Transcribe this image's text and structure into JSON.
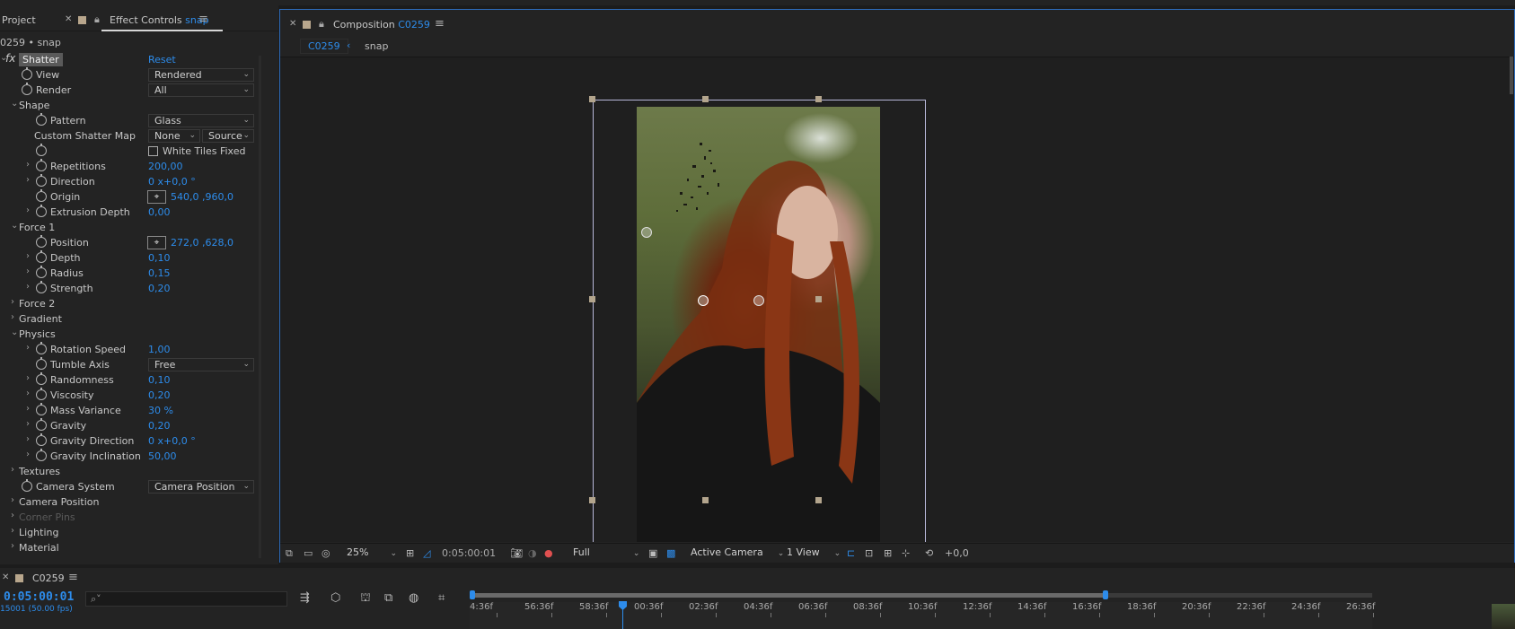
{
  "project_tab": "Project",
  "effect_controls_tab": {
    "label": "Effect Controls",
    "layer": "snap"
  },
  "effect_controls_subtitle": "0259 • snap",
  "effect": {
    "badge": "fx",
    "name": "Shatter",
    "reset": "Reset"
  },
  "rows": [
    {
      "id": "view",
      "label": "View",
      "dropdown": "Rendered"
    },
    {
      "id": "render",
      "label": "Render",
      "dropdown": "All"
    },
    {
      "id": "shape",
      "label": "Shape"
    },
    {
      "id": "pattern",
      "label": "Pattern",
      "dropdown": "Glass"
    },
    {
      "id": "custom-shatter-map",
      "label": "Custom Shatter Map",
      "dd1": "None",
      "dd2": "Source"
    },
    {
      "id": "white-tiles-fixed",
      "label": "White Tiles Fixed"
    },
    {
      "id": "repetitions",
      "label": "Repetitions",
      "value": "200,00"
    },
    {
      "id": "direction",
      "label": "Direction",
      "value": "0 x+0,0 °"
    },
    {
      "id": "origin",
      "label": "Origin",
      "value": "540,0 ,960,0"
    },
    {
      "id": "extrusion-depth",
      "label": "Extrusion Depth",
      "value": "0,00"
    },
    {
      "id": "force1",
      "label": "Force 1"
    },
    {
      "id": "position",
      "label": "Position",
      "value": "272,0 ,628,0"
    },
    {
      "id": "depth",
      "label": "Depth",
      "value": "0,10"
    },
    {
      "id": "radius",
      "label": "Radius",
      "value": "0,15"
    },
    {
      "id": "strength",
      "label": "Strength",
      "value": "0,20"
    },
    {
      "id": "force2",
      "label": "Force 2"
    },
    {
      "id": "gradient",
      "label": "Gradient"
    },
    {
      "id": "physics",
      "label": "Physics"
    },
    {
      "id": "rotation-speed",
      "label": "Rotation Speed",
      "value": "1,00"
    },
    {
      "id": "tumble-axis",
      "label": "Tumble Axis",
      "dropdown": "Free"
    },
    {
      "id": "randomness",
      "label": "Randomness",
      "value": "0,10"
    },
    {
      "id": "viscosity",
      "label": "Viscosity",
      "value": "0,20"
    },
    {
      "id": "mass-variance",
      "label": "Mass Variance",
      "value": "30 %"
    },
    {
      "id": "gravity",
      "label": "Gravity",
      "value": "0,20"
    },
    {
      "id": "gravity-direction",
      "label": "Gravity Direction",
      "value": "0 x+0,0 °"
    },
    {
      "id": "gravity-inclination",
      "label": "Gravity Inclination",
      "value": "50,00"
    },
    {
      "id": "textures",
      "label": "Textures"
    },
    {
      "id": "camera-system",
      "label": "Camera System",
      "dropdown": "Camera Position"
    },
    {
      "id": "camera-position",
      "label": "Camera Position"
    },
    {
      "id": "corner-pins",
      "label": "Corner Pins"
    },
    {
      "id": "lighting",
      "label": "Lighting"
    },
    {
      "id": "material",
      "label": "Material"
    }
  ],
  "composition": {
    "tab_label": "Composition",
    "comp_name": "C0259",
    "breadcrumb": [
      "C0259",
      "snap"
    ],
    "zoom": "25%",
    "timecode": "0:05:00:01",
    "resolution": "Full",
    "camera": "Active Camera",
    "views": "1 View",
    "exposure": "+0,0"
  },
  "timeline": {
    "comp_name": "C0259",
    "timecode": "0:05:00:01",
    "frame_info": "15001 (50.00 fps)",
    "search_placeholder": "⌕˅",
    "ticks": [
      "4:36f",
      "56:36f",
      "58:36f",
      "00:36f",
      "02:36f",
      "04:36f",
      "06:36f",
      "08:36f",
      "10:36f",
      "12:36f",
      "14:36f",
      "16:36f",
      "18:36f",
      "20:36f",
      "22:36f",
      "24:36f",
      "26:36f"
    ]
  },
  "colors": {
    "accent": "#2d8ceb",
    "panel": "#232323",
    "highlight_border": "#2d6ab8"
  }
}
